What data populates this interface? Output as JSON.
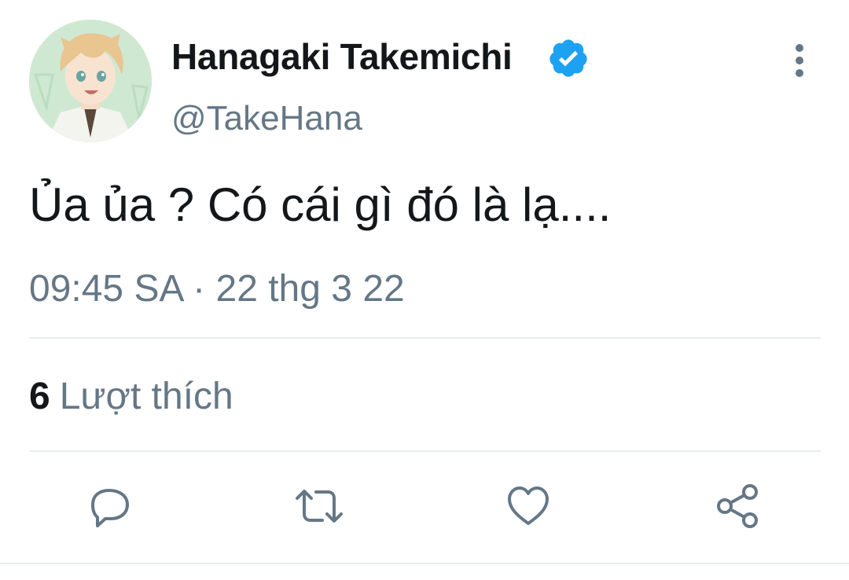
{
  "tweet": {
    "display_name": "Hanagaki Takemichi",
    "handle": "@TakeHana",
    "verified": true,
    "text": "Ủa ủa ? Có cái gì đó là lạ....",
    "timestamp": "09:45 SA · 22 thg 3 22",
    "likes_count": "6",
    "likes_label": "Lượt thích"
  },
  "colors": {
    "text_primary": "#14171a",
    "text_secondary": "#657786",
    "verified_blue": "#1da1f2",
    "divider": "#e6ecf0"
  },
  "icons": {
    "reply": "reply-icon",
    "retweet": "retweet-icon",
    "like": "heart-icon",
    "share": "share-icon",
    "more": "more-vertical-icon",
    "verified": "verified-badge-icon"
  }
}
